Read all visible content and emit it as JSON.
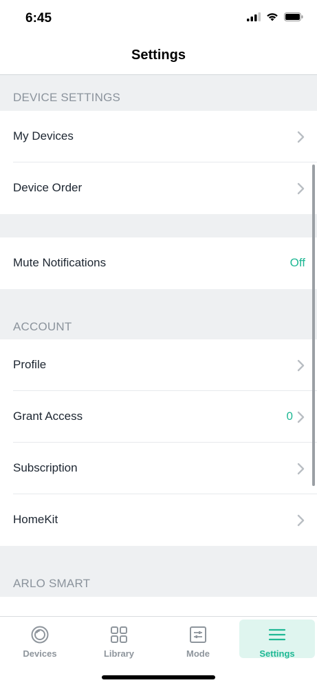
{
  "status_bar": {
    "time": "6:45"
  },
  "nav": {
    "title": "Settings"
  },
  "sections": {
    "device_settings": {
      "header": "DEVICE SETTINGS",
      "rows": {
        "my_devices": "My Devices",
        "device_order": "Device Order"
      }
    },
    "notifications": {
      "mute_label": "Mute Notifications",
      "mute_value": "Off"
    },
    "account": {
      "header": "ACCOUNT",
      "rows": {
        "profile": "Profile",
        "grant_access": "Grant Access",
        "grant_access_count": "0",
        "subscription": "Subscription",
        "homekit": "HomeKit"
      }
    },
    "arlo_smart": {
      "header": "ARLO SMART"
    }
  },
  "tabs": {
    "devices": "Devices",
    "library": "Library",
    "mode": "Mode",
    "settings": "Settings",
    "active": "settings"
  },
  "colors": {
    "accent": "#1fb894",
    "section_bg": "#eef0f2",
    "active_tab_bg": "#dff5ef"
  },
  "icons": [
    "cellular-signal-icon",
    "wifi-icon",
    "battery-icon",
    "chevron-right-icon",
    "camera-lens-icon",
    "grid-icon",
    "sliders-icon",
    "menu-icon"
  ]
}
